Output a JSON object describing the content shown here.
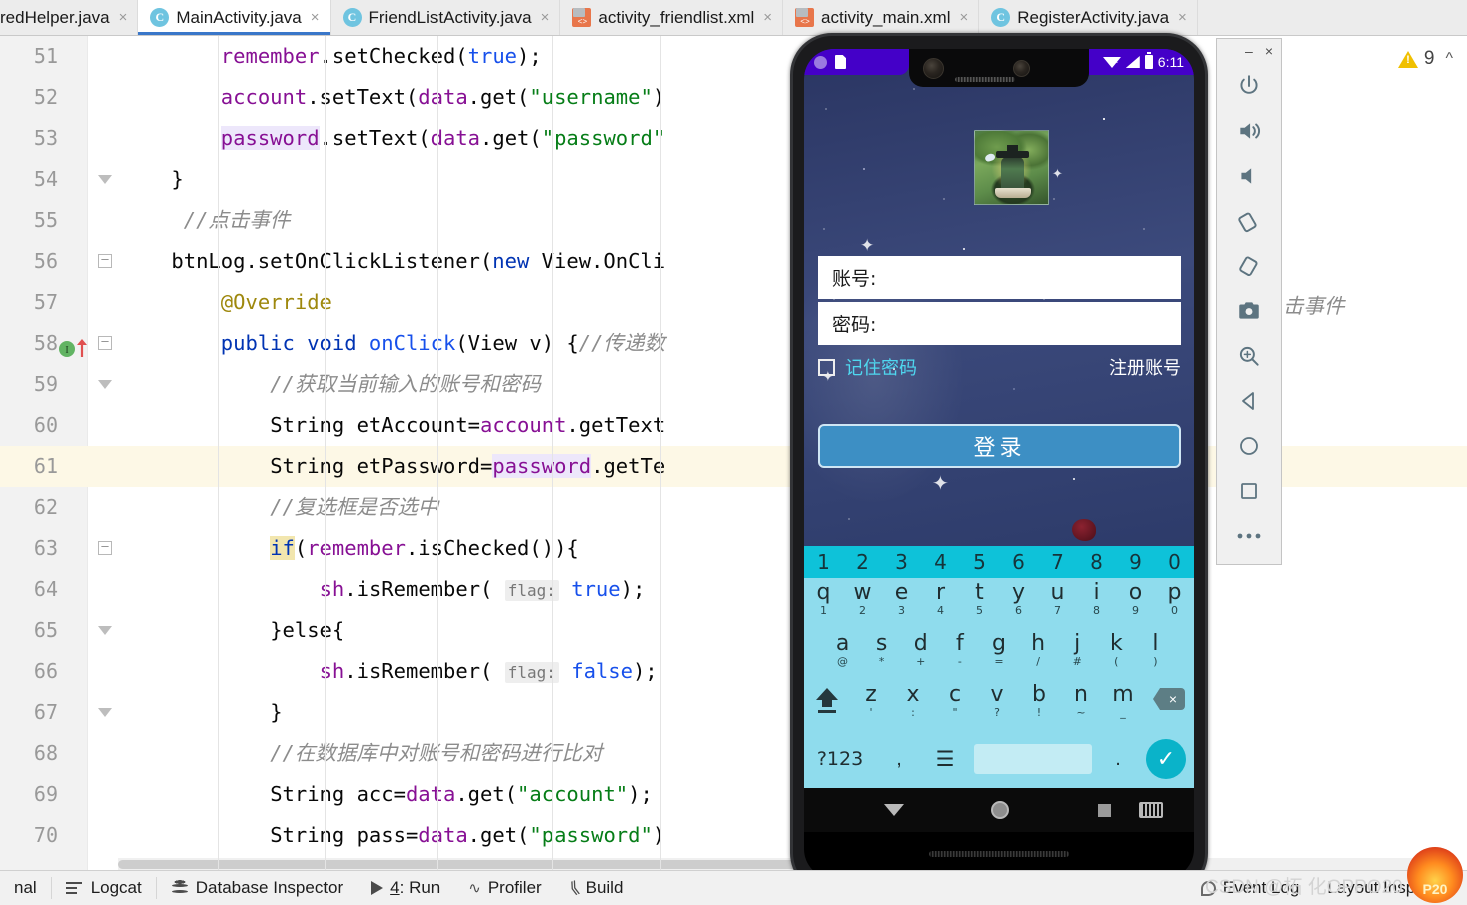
{
  "tabs": [
    {
      "label": "redHelper.java",
      "icon": "java-class-icon",
      "type": "java",
      "active": false,
      "partial": true
    },
    {
      "label": "MainActivity.java",
      "icon": "java-class-icon",
      "type": "java",
      "active": true,
      "partial": false
    },
    {
      "label": "FriendListActivity.java",
      "icon": "java-class-icon",
      "type": "java",
      "active": false,
      "partial": false
    },
    {
      "label": "activity_friendlist.xml",
      "icon": "xml-layout-icon",
      "type": "xml",
      "active": false,
      "partial": false
    },
    {
      "label": "activity_main.xml",
      "icon": "xml-layout-icon",
      "type": "xml",
      "active": false,
      "partial": false
    },
    {
      "label": "RegisterActivity.java",
      "icon": "java-class-icon",
      "type": "java",
      "active": false,
      "partial": false
    }
  ],
  "editor": {
    "warning_count": "9",
    "stray_text_behind_emulator": "击事件",
    "lines": [
      {
        "num": "51",
        "indent": 8,
        "segs": [
          {
            "t": "remember",
            "c": "fld"
          },
          {
            "t": ".setChecked(",
            "c": "plain"
          },
          {
            "t": "true",
            "c": "num"
          },
          {
            "t": ");",
            "c": "plain"
          }
        ]
      },
      {
        "num": "52",
        "indent": 8,
        "segs": [
          {
            "t": "account",
            "c": "fld"
          },
          {
            "t": ".setText(",
            "c": "plain"
          },
          {
            "t": "data",
            "c": "fld"
          },
          {
            "t": ".get(",
            "c": "plain"
          },
          {
            "t": "\"username\"",
            "c": "str"
          },
          {
            "t": ")",
            "c": "plain"
          }
        ]
      },
      {
        "num": "53",
        "indent": 8,
        "segs": [
          {
            "t": "password",
            "c": "fld ident-hl"
          },
          {
            "t": ".setText(",
            "c": "plain"
          },
          {
            "t": "data",
            "c": "fld"
          },
          {
            "t": ".get(",
            "c": "plain"
          },
          {
            "t": "\"password\"",
            "c": "str"
          }
        ]
      },
      {
        "num": "54",
        "indent": 4,
        "fold": "end",
        "segs": [
          {
            "t": "}",
            "c": "plain"
          }
        ]
      },
      {
        "num": "55",
        "indent": 5,
        "segs": [
          {
            "t": "//点击事件",
            "c": "cmt"
          }
        ]
      },
      {
        "num": "56",
        "indent": 4,
        "fold": "start",
        "segs": [
          {
            "t": "btnLog",
            "c": "plain"
          },
          {
            "t": ".setOnClickListener(",
            "c": "plain"
          },
          {
            "t": "new",
            "c": "kw"
          },
          {
            "t": " View.OnCli",
            "c": "plain"
          }
        ]
      },
      {
        "num": "57",
        "indent": 8,
        "segs": [
          {
            "t": "@Override",
            "c": "anno"
          }
        ]
      },
      {
        "num": "58",
        "indent": 8,
        "marker": "implemented-method-marker",
        "fold": "start",
        "segs": [
          {
            "t": "public",
            "c": "kw"
          },
          {
            "t": " ",
            "c": "plain"
          },
          {
            "t": "void",
            "c": "kw"
          },
          {
            "t": " ",
            "c": "plain"
          },
          {
            "t": "onClick",
            "c": "num"
          },
          {
            "t": "(View v) {",
            "c": "plain"
          },
          {
            "t": "//传递数",
            "c": "cmt"
          }
        ]
      },
      {
        "num": "59",
        "indent": 12,
        "fold": "end",
        "segs": [
          {
            "t": "//获取当前输入的账号和密码",
            "c": "cmt"
          }
        ]
      },
      {
        "num": "60",
        "indent": 12,
        "segs": [
          {
            "t": "String etAccount=",
            "c": "plain"
          },
          {
            "t": "account",
            "c": "fld"
          },
          {
            "t": ".getText",
            "c": "plain"
          }
        ]
      },
      {
        "num": "61",
        "indent": 12,
        "highlight": true,
        "segs": [
          {
            "t": "String etPassword=",
            "c": "plain"
          },
          {
            "t": "password",
            "c": "fld ident-hl"
          },
          {
            "t": ".getTe",
            "c": "plain"
          }
        ]
      },
      {
        "num": "62",
        "indent": 12,
        "segs": [
          {
            "t": "//复选框是否选中",
            "c": "cmt"
          }
        ]
      },
      {
        "num": "63",
        "indent": 12,
        "fold": "start",
        "segs": [
          {
            "t": "if",
            "c": "kw-hl"
          },
          {
            "t": "(",
            "c": "plain"
          },
          {
            "t": "remember",
            "c": "fld"
          },
          {
            "t": ".isChecked()){",
            "c": "plain"
          }
        ]
      },
      {
        "num": "64",
        "indent": 16,
        "segs": [
          {
            "t": "sh",
            "c": "fld"
          },
          {
            "t": ".isRemember( ",
            "c": "plain"
          },
          {
            "t": "flag:",
            "c": "param-hint"
          },
          {
            "t": " ",
            "c": "plain"
          },
          {
            "t": "true",
            "c": "num"
          },
          {
            "t": ");",
            "c": "plain"
          }
        ]
      },
      {
        "num": "65",
        "indent": 12,
        "fold": "end",
        "segs": [
          {
            "t": "}else{",
            "c": "plain"
          }
        ]
      },
      {
        "num": "66",
        "indent": 16,
        "segs": [
          {
            "t": "sh",
            "c": "fld"
          },
          {
            "t": ".isRemember( ",
            "c": "plain"
          },
          {
            "t": "flag:",
            "c": "param-hint"
          },
          {
            "t": " ",
            "c": "plain"
          },
          {
            "t": "false",
            "c": "num"
          },
          {
            "t": ");",
            "c": "plain"
          }
        ]
      },
      {
        "num": "67",
        "indent": 12,
        "fold": "end",
        "segs": [
          {
            "t": "}",
            "c": "plain"
          }
        ]
      },
      {
        "num": "68",
        "indent": 12,
        "segs": [
          {
            "t": "//在数据库中对账号和密码进行比对",
            "c": "cmt"
          }
        ]
      },
      {
        "num": "69",
        "indent": 12,
        "segs": [
          {
            "t": "String acc=",
            "c": "plain"
          },
          {
            "t": "data",
            "c": "fld"
          },
          {
            "t": ".get(",
            "c": "plain"
          },
          {
            "t": "\"account\"",
            "c": "str"
          },
          {
            "t": ");",
            "c": "plain"
          }
        ]
      },
      {
        "num": "70",
        "indent": 12,
        "segs": [
          {
            "t": "String pass=",
            "c": "plain"
          },
          {
            "t": "data",
            "c": "fld"
          },
          {
            "t": ".get(",
            "c": "plain"
          },
          {
            "t": "\"password\"",
            "c": "str"
          },
          {
            "t": ")",
            "c": "plain"
          }
        ]
      }
    ]
  },
  "emulator": {
    "window_minimize": "–",
    "window_close": "×",
    "status_bar": {
      "time": "6:11"
    },
    "app": {
      "account_label": "账号:",
      "password_label": "密码:",
      "remember_label": "记住密码",
      "register_link": "注册账号",
      "login_button": "登录"
    },
    "keyboard": {
      "numbers": [
        "1",
        "2",
        "3",
        "4",
        "5",
        "6",
        "7",
        "8",
        "9",
        "0"
      ],
      "row1": [
        {
          "main": "q",
          "sub": "1"
        },
        {
          "main": "w",
          "sub": "2"
        },
        {
          "main": "e",
          "sub": "3"
        },
        {
          "main": "r",
          "sub": "4"
        },
        {
          "main": "t",
          "sub": "5"
        },
        {
          "main": "y",
          "sub": "6"
        },
        {
          "main": "u",
          "sub": "7"
        },
        {
          "main": "i",
          "sub": "8"
        },
        {
          "main": "o",
          "sub": "9"
        },
        {
          "main": "p",
          "sub": "0"
        }
      ],
      "row2": [
        {
          "main": "a",
          "sub": "@"
        },
        {
          "main": "s",
          "sub": "*"
        },
        {
          "main": "d",
          "sub": "+"
        },
        {
          "main": "f",
          "sub": "-"
        },
        {
          "main": "g",
          "sub": "="
        },
        {
          "main": "h",
          "sub": "/"
        },
        {
          "main": "j",
          "sub": "#"
        },
        {
          "main": "k",
          "sub": "("
        },
        {
          "main": "l",
          "sub": ")"
        }
      ],
      "row3": [
        {
          "main": "z",
          "sub": "'"
        },
        {
          "main": "x",
          "sub": ":"
        },
        {
          "main": "c",
          "sub": "\""
        },
        {
          "main": "v",
          "sub": "?"
        },
        {
          "main": "b",
          "sub": "!"
        },
        {
          "main": "n",
          "sub": "~"
        },
        {
          "main": "m",
          "sub": "_"
        }
      ],
      "symbols_key": "?123",
      "comma_key": ",",
      "globe_key": "🌐",
      "period_key": ".",
      "enter_key": "✓"
    },
    "toolbar": [
      {
        "name": "power-icon",
        "label": "Power"
      },
      {
        "name": "volume-up-icon",
        "label": "Volume Up"
      },
      {
        "name": "volume-down-icon",
        "label": "Volume Down"
      },
      {
        "name": "rotate-left-icon",
        "label": "Rotate Left"
      },
      {
        "name": "rotate-right-icon",
        "label": "Rotate Right"
      },
      {
        "name": "screenshot-camera-icon",
        "label": "Take Screenshot"
      },
      {
        "name": "zoom-icon",
        "label": "Zoom Mode"
      },
      {
        "name": "back-triangle-icon",
        "label": "Back"
      },
      {
        "name": "home-circle-icon",
        "label": "Home"
      },
      {
        "name": "overview-square-icon",
        "label": "Overview"
      },
      {
        "name": "more-ellipsis-icon",
        "label": "Extended Controls"
      }
    ]
  },
  "statusbar": {
    "left_items": [
      {
        "label": "nal",
        "icon": "terminal-icon"
      },
      {
        "label": "Logcat",
        "icon": "logcat-icon"
      },
      {
        "label": "Database Inspector",
        "icon": "database-icon"
      },
      {
        "label": "4: Run",
        "icon": "run-play-icon",
        "mnemonic": "4"
      },
      {
        "label": "Profiler",
        "icon": "profiler-icon"
      },
      {
        "label": "Build",
        "icon": "build-hammer-icon"
      }
    ],
    "right_items": [
      {
        "label": "Event Log",
        "icon": "event-log-icon"
      },
      {
        "label": "Layout Inspector",
        "icon": "layout-inspector-icon"
      }
    ]
  },
  "watermark": {
    "text": "CSDN @柘 化OPPO20",
    "logo_text": "P20"
  },
  "colors": {
    "tab_active_underline": "#3a77c9",
    "android_status_purple": "#4400c8",
    "keyboard_bg": "#8fdced",
    "keyboard_numrow": "#0ec2d9",
    "login_button": "#3d8fc4",
    "remember_label": "#4fd8f0",
    "warning_yellow": "#f0c000",
    "highlight_line": "#fdf8e6"
  }
}
